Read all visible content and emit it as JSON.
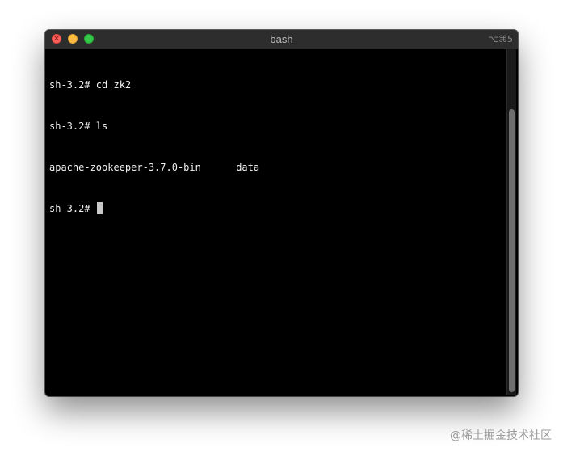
{
  "window": {
    "title": "bash",
    "shortcut": "⌥⌘5",
    "close_glyph": "×"
  },
  "terminal": {
    "lines": [
      "sh-3.2# cd zk2",
      "sh-3.2# ls",
      "apache-zookeeper-3.7.0-bin      data",
      "sh-3.2# "
    ]
  },
  "watermark": "@稀土掘金技术社区",
  "colors": {
    "terminal_bg": "#000000",
    "text": "#f0f0f0",
    "close": "#fc615d",
    "minimize": "#fdbc40",
    "zoom": "#34c84a"
  }
}
